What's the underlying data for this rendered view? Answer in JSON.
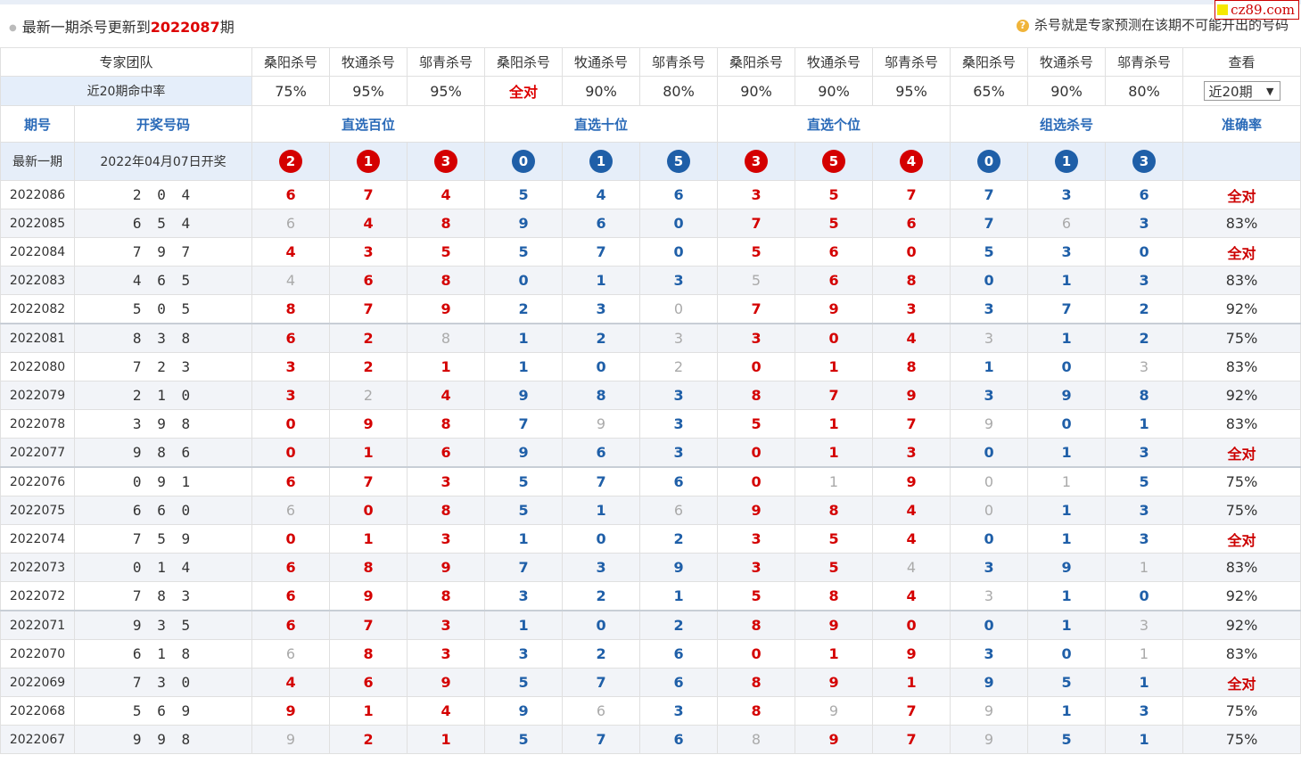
{
  "header": {
    "prefix": "最新一期杀号更新到",
    "issue": "2022087",
    "suffix": "期",
    "note": "杀号就是专家预测在该期不可能开出的号码",
    "logo": "cz89.com"
  },
  "teams": {
    "label": "专家团队",
    "names": [
      "桑阳杀号",
      "牧通杀号",
      "邬青杀号",
      "桑阳杀号",
      "牧通杀号",
      "邬青杀号",
      "桑阳杀号",
      "牧通杀号",
      "邬青杀号",
      "桑阳杀号",
      "牧通杀号",
      "邬青杀号"
    ],
    "view_label": "查看"
  },
  "rates": {
    "label": "近20期命中率",
    "values": [
      "75%",
      "95%",
      "95%",
      "全对",
      "90%",
      "80%",
      "90%",
      "90%",
      "95%",
      "65%",
      "90%",
      "80%"
    ],
    "select_value": "近20期"
  },
  "sections": {
    "issue": "期号",
    "draw": "开奖号码",
    "hundreds": "直选百位",
    "tens": "直选十位",
    "units": "直选个位",
    "group": "组选杀号",
    "accuracy": "准确率"
  },
  "latest": {
    "label": "最新一期",
    "date": "2022年04月07日开奖",
    "balls": [
      "2",
      "1",
      "3",
      "0",
      "1",
      "5",
      "3",
      "5",
      "4",
      "0",
      "1",
      "3"
    ]
  },
  "colors": {
    "red": "#d40000",
    "blue": "#1f5fa8",
    "gray": "#aaaaaa",
    "accent": "#2a6ab8"
  },
  "rows": [
    {
      "issue": "2022086",
      "draw": "2 0 4",
      "nums": [
        "6",
        "7",
        "4",
        "5",
        "4",
        "6",
        "3",
        "5",
        "7",
        "7",
        "3",
        "6"
      ],
      "g": [
        0,
        0,
        0,
        0,
        0,
        0,
        0,
        0,
        0,
        0,
        0,
        0
      ],
      "acc": "全对"
    },
    {
      "issue": "2022085",
      "draw": "6 5 4",
      "nums": [
        "6",
        "4",
        "8",
        "9",
        "6",
        "0",
        "7",
        "5",
        "6",
        "7",
        "6",
        "3"
      ],
      "g": [
        1,
        0,
        0,
        0,
        0,
        0,
        0,
        0,
        0,
        0,
        1,
        0
      ],
      "acc": "83%"
    },
    {
      "issue": "2022084",
      "draw": "7 9 7",
      "nums": [
        "4",
        "3",
        "5",
        "5",
        "7",
        "0",
        "5",
        "6",
        "0",
        "5",
        "3",
        "0"
      ],
      "g": [
        0,
        0,
        0,
        0,
        0,
        0,
        0,
        0,
        0,
        0,
        0,
        0
      ],
      "acc": "全对"
    },
    {
      "issue": "2022083",
      "draw": "4 6 5",
      "nums": [
        "4",
        "6",
        "8",
        "0",
        "1",
        "3",
        "5",
        "6",
        "8",
        "0",
        "1",
        "3"
      ],
      "g": [
        1,
        0,
        0,
        0,
        0,
        0,
        1,
        0,
        0,
        0,
        0,
        0
      ],
      "acc": "83%"
    },
    {
      "issue": "2022082",
      "draw": "5 0 5",
      "nums": [
        "8",
        "7",
        "9",
        "2",
        "3",
        "0",
        "7",
        "9",
        "3",
        "3",
        "7",
        "2"
      ],
      "g": [
        0,
        0,
        0,
        0,
        0,
        1,
        0,
        0,
        0,
        0,
        0,
        0
      ],
      "acc": "92%"
    },
    {
      "issue": "2022081",
      "draw": "8 3 8",
      "nums": [
        "6",
        "2",
        "8",
        "1",
        "2",
        "3",
        "3",
        "0",
        "4",
        "3",
        "1",
        "2"
      ],
      "g": [
        0,
        0,
        1,
        0,
        0,
        1,
        0,
        0,
        0,
        1,
        0,
        0
      ],
      "acc": "75%"
    },
    {
      "issue": "2022080",
      "draw": "7 2 3",
      "nums": [
        "3",
        "2",
        "1",
        "1",
        "0",
        "2",
        "0",
        "1",
        "8",
        "1",
        "0",
        "3"
      ],
      "g": [
        0,
        0,
        0,
        0,
        0,
        1,
        0,
        0,
        0,
        0,
        0,
        1
      ],
      "acc": "83%"
    },
    {
      "issue": "2022079",
      "draw": "2 1 0",
      "nums": [
        "3",
        "2",
        "4",
        "9",
        "8",
        "3",
        "8",
        "7",
        "9",
        "3",
        "9",
        "8"
      ],
      "g": [
        0,
        1,
        0,
        0,
        0,
        0,
        0,
        0,
        0,
        0,
        0,
        0
      ],
      "acc": "92%"
    },
    {
      "issue": "2022078",
      "draw": "3 9 8",
      "nums": [
        "0",
        "9",
        "8",
        "7",
        "9",
        "3",
        "5",
        "1",
        "7",
        "9",
        "0",
        "1"
      ],
      "g": [
        0,
        0,
        0,
        0,
        1,
        0,
        0,
        0,
        0,
        1,
        0,
        0
      ],
      "acc": "83%"
    },
    {
      "issue": "2022077",
      "draw": "9 8 6",
      "nums": [
        "0",
        "1",
        "6",
        "9",
        "6",
        "3",
        "0",
        "1",
        "3",
        "0",
        "1",
        "3"
      ],
      "g": [
        0,
        0,
        0,
        0,
        0,
        0,
        0,
        0,
        0,
        0,
        0,
        0
      ],
      "acc": "全对"
    },
    {
      "issue": "2022076",
      "draw": "0 9 1",
      "nums": [
        "6",
        "7",
        "3",
        "5",
        "7",
        "6",
        "0",
        "1",
        "9",
        "0",
        "1",
        "5"
      ],
      "g": [
        0,
        0,
        0,
        0,
        0,
        0,
        0,
        1,
        0,
        1,
        1,
        0
      ],
      "acc": "75%"
    },
    {
      "issue": "2022075",
      "draw": "6 6 0",
      "nums": [
        "6",
        "0",
        "8",
        "5",
        "1",
        "6",
        "9",
        "8",
        "4",
        "0",
        "1",
        "3"
      ],
      "g": [
        1,
        0,
        0,
        0,
        0,
        1,
        0,
        0,
        0,
        1,
        0,
        0
      ],
      "acc": "75%"
    },
    {
      "issue": "2022074",
      "draw": "7 5 9",
      "nums": [
        "0",
        "1",
        "3",
        "1",
        "0",
        "2",
        "3",
        "5",
        "4",
        "0",
        "1",
        "3"
      ],
      "g": [
        0,
        0,
        0,
        0,
        0,
        0,
        0,
        0,
        0,
        0,
        0,
        0
      ],
      "acc": "全对"
    },
    {
      "issue": "2022073",
      "draw": "0 1 4",
      "nums": [
        "6",
        "8",
        "9",
        "7",
        "3",
        "9",
        "3",
        "5",
        "4",
        "3",
        "9",
        "1"
      ],
      "g": [
        0,
        0,
        0,
        0,
        0,
        0,
        0,
        0,
        1,
        0,
        0,
        1
      ],
      "acc": "83%"
    },
    {
      "issue": "2022072",
      "draw": "7 8 3",
      "nums": [
        "6",
        "9",
        "8",
        "3",
        "2",
        "1",
        "5",
        "8",
        "4",
        "3",
        "1",
        "0"
      ],
      "g": [
        0,
        0,
        0,
        0,
        0,
        0,
        0,
        0,
        0,
        1,
        0,
        0
      ],
      "acc": "92%"
    },
    {
      "issue": "2022071",
      "draw": "9 3 5",
      "nums": [
        "6",
        "7",
        "3",
        "1",
        "0",
        "2",
        "8",
        "9",
        "0",
        "0",
        "1",
        "3"
      ],
      "g": [
        0,
        0,
        0,
        0,
        0,
        0,
        0,
        0,
        0,
        0,
        0,
        1
      ],
      "acc": "92%"
    },
    {
      "issue": "2022070",
      "draw": "6 1 8",
      "nums": [
        "6",
        "8",
        "3",
        "3",
        "2",
        "6",
        "0",
        "1",
        "9",
        "3",
        "0",
        "1"
      ],
      "g": [
        1,
        0,
        0,
        0,
        0,
        0,
        0,
        0,
        0,
        0,
        0,
        1
      ],
      "acc": "83%"
    },
    {
      "issue": "2022069",
      "draw": "7 3 0",
      "nums": [
        "4",
        "6",
        "9",
        "5",
        "7",
        "6",
        "8",
        "9",
        "1",
        "9",
        "5",
        "1"
      ],
      "g": [
        0,
        0,
        0,
        0,
        0,
        0,
        0,
        0,
        0,
        0,
        0,
        0
      ],
      "acc": "全对"
    },
    {
      "issue": "2022068",
      "draw": "5 6 9",
      "nums": [
        "9",
        "1",
        "4",
        "9",
        "6",
        "3",
        "8",
        "9",
        "7",
        "9",
        "1",
        "3"
      ],
      "g": [
        0,
        0,
        0,
        0,
        1,
        0,
        0,
        1,
        0,
        1,
        0,
        0
      ],
      "acc": "75%"
    },
    {
      "issue": "2022067",
      "draw": "9 9 8",
      "nums": [
        "9",
        "2",
        "1",
        "5",
        "7",
        "6",
        "8",
        "9",
        "7",
        "9",
        "5",
        "1"
      ],
      "g": [
        1,
        0,
        0,
        0,
        0,
        0,
        1,
        0,
        0,
        1,
        0,
        0
      ],
      "acc": "75%"
    }
  ]
}
